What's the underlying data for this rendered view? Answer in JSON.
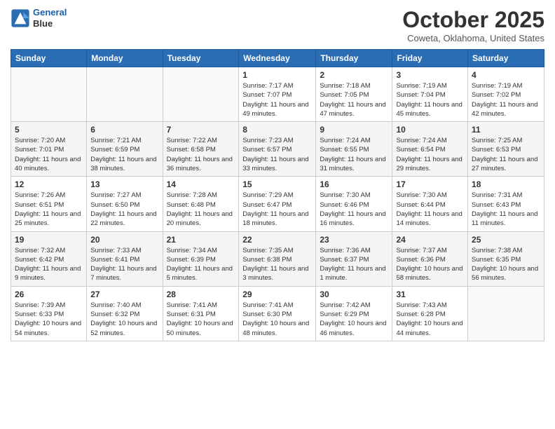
{
  "header": {
    "logo_line1": "General",
    "logo_line2": "Blue",
    "month": "October 2025",
    "location": "Coweta, Oklahoma, United States"
  },
  "weekdays": [
    "Sunday",
    "Monday",
    "Tuesday",
    "Wednesday",
    "Thursday",
    "Friday",
    "Saturday"
  ],
  "weeks": [
    [
      {
        "day": "",
        "info": ""
      },
      {
        "day": "",
        "info": ""
      },
      {
        "day": "",
        "info": ""
      },
      {
        "day": "1",
        "info": "Sunrise: 7:17 AM\nSunset: 7:07 PM\nDaylight: 11 hours and 49 minutes."
      },
      {
        "day": "2",
        "info": "Sunrise: 7:18 AM\nSunset: 7:05 PM\nDaylight: 11 hours and 47 minutes."
      },
      {
        "day": "3",
        "info": "Sunrise: 7:19 AM\nSunset: 7:04 PM\nDaylight: 11 hours and 45 minutes."
      },
      {
        "day": "4",
        "info": "Sunrise: 7:19 AM\nSunset: 7:02 PM\nDaylight: 11 hours and 42 minutes."
      }
    ],
    [
      {
        "day": "5",
        "info": "Sunrise: 7:20 AM\nSunset: 7:01 PM\nDaylight: 11 hours and 40 minutes."
      },
      {
        "day": "6",
        "info": "Sunrise: 7:21 AM\nSunset: 6:59 PM\nDaylight: 11 hours and 38 minutes."
      },
      {
        "day": "7",
        "info": "Sunrise: 7:22 AM\nSunset: 6:58 PM\nDaylight: 11 hours and 36 minutes."
      },
      {
        "day": "8",
        "info": "Sunrise: 7:23 AM\nSunset: 6:57 PM\nDaylight: 11 hours and 33 minutes."
      },
      {
        "day": "9",
        "info": "Sunrise: 7:24 AM\nSunset: 6:55 PM\nDaylight: 11 hours and 31 minutes."
      },
      {
        "day": "10",
        "info": "Sunrise: 7:24 AM\nSunset: 6:54 PM\nDaylight: 11 hours and 29 minutes."
      },
      {
        "day": "11",
        "info": "Sunrise: 7:25 AM\nSunset: 6:53 PM\nDaylight: 11 hours and 27 minutes."
      }
    ],
    [
      {
        "day": "12",
        "info": "Sunrise: 7:26 AM\nSunset: 6:51 PM\nDaylight: 11 hours and 25 minutes."
      },
      {
        "day": "13",
        "info": "Sunrise: 7:27 AM\nSunset: 6:50 PM\nDaylight: 11 hours and 22 minutes."
      },
      {
        "day": "14",
        "info": "Sunrise: 7:28 AM\nSunset: 6:48 PM\nDaylight: 11 hours and 20 minutes."
      },
      {
        "day": "15",
        "info": "Sunrise: 7:29 AM\nSunset: 6:47 PM\nDaylight: 11 hours and 18 minutes."
      },
      {
        "day": "16",
        "info": "Sunrise: 7:30 AM\nSunset: 6:46 PM\nDaylight: 11 hours and 16 minutes."
      },
      {
        "day": "17",
        "info": "Sunrise: 7:30 AM\nSunset: 6:44 PM\nDaylight: 11 hours and 14 minutes."
      },
      {
        "day": "18",
        "info": "Sunrise: 7:31 AM\nSunset: 6:43 PM\nDaylight: 11 hours and 11 minutes."
      }
    ],
    [
      {
        "day": "19",
        "info": "Sunrise: 7:32 AM\nSunset: 6:42 PM\nDaylight: 11 hours and 9 minutes."
      },
      {
        "day": "20",
        "info": "Sunrise: 7:33 AM\nSunset: 6:41 PM\nDaylight: 11 hours and 7 minutes."
      },
      {
        "day": "21",
        "info": "Sunrise: 7:34 AM\nSunset: 6:39 PM\nDaylight: 11 hours and 5 minutes."
      },
      {
        "day": "22",
        "info": "Sunrise: 7:35 AM\nSunset: 6:38 PM\nDaylight: 11 hours and 3 minutes."
      },
      {
        "day": "23",
        "info": "Sunrise: 7:36 AM\nSunset: 6:37 PM\nDaylight: 11 hours and 1 minute."
      },
      {
        "day": "24",
        "info": "Sunrise: 7:37 AM\nSunset: 6:36 PM\nDaylight: 10 hours and 58 minutes."
      },
      {
        "day": "25",
        "info": "Sunrise: 7:38 AM\nSunset: 6:35 PM\nDaylight: 10 hours and 56 minutes."
      }
    ],
    [
      {
        "day": "26",
        "info": "Sunrise: 7:39 AM\nSunset: 6:33 PM\nDaylight: 10 hours and 54 minutes."
      },
      {
        "day": "27",
        "info": "Sunrise: 7:40 AM\nSunset: 6:32 PM\nDaylight: 10 hours and 52 minutes."
      },
      {
        "day": "28",
        "info": "Sunrise: 7:41 AM\nSunset: 6:31 PM\nDaylight: 10 hours and 50 minutes."
      },
      {
        "day": "29",
        "info": "Sunrise: 7:41 AM\nSunset: 6:30 PM\nDaylight: 10 hours and 48 minutes."
      },
      {
        "day": "30",
        "info": "Sunrise: 7:42 AM\nSunset: 6:29 PM\nDaylight: 10 hours and 46 minutes."
      },
      {
        "day": "31",
        "info": "Sunrise: 7:43 AM\nSunset: 6:28 PM\nDaylight: 10 hours and 44 minutes."
      },
      {
        "day": "",
        "info": ""
      }
    ]
  ]
}
